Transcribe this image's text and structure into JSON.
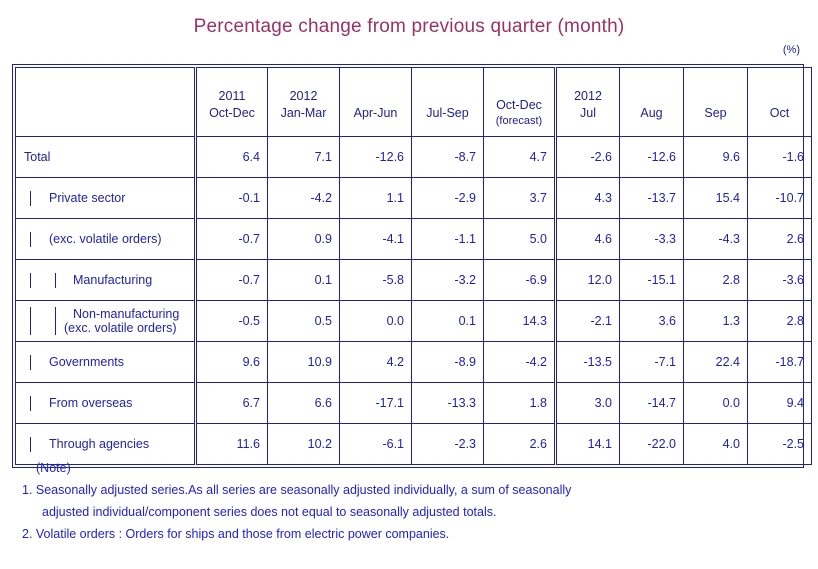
{
  "title": "Percentage change from previous quarter (month)",
  "unit": "(%)",
  "header": {
    "blank": "",
    "quarters": [
      {
        "year": "2011",
        "period": "Oct-Dec",
        "sub": ""
      },
      {
        "year": "2012",
        "period": "Jan-Mar",
        "sub": ""
      },
      {
        "year": "",
        "period": "Apr-Jun",
        "sub": ""
      },
      {
        "year": "",
        "period": "Jul-Sep",
        "sub": ""
      },
      {
        "year": "",
        "period": "Oct-Dec",
        "sub": "(forecast)"
      }
    ],
    "months": [
      {
        "year": "2012",
        "period": "Jul",
        "sub": ""
      },
      {
        "year": "",
        "period": "Aug",
        "sub": ""
      },
      {
        "year": "",
        "period": "Sep",
        "sub": ""
      },
      {
        "year": "",
        "period": "Oct",
        "sub": ""
      }
    ]
  },
  "rows": [
    {
      "label": "Total",
      "label2": "",
      "level": 0,
      "values": [
        "6.4",
        "7.1",
        "-12.6",
        "-8.7",
        "4.7",
        "-2.6",
        "-12.6",
        "9.6",
        "-1.6"
      ]
    },
    {
      "label": "Private sector",
      "label2": "",
      "level": 1,
      "values": [
        "-0.1",
        "-4.2",
        "1.1",
        "-2.9",
        "3.7",
        "4.3",
        "-13.7",
        "15.4",
        "-10.7"
      ]
    },
    {
      "label": "(exc. volatile orders)",
      "label2": "",
      "level": 1,
      "values": [
        "-0.7",
        "0.9",
        "-4.1",
        "-1.1",
        "5.0",
        "4.6",
        "-3.3",
        "-4.3",
        "2.6"
      ]
    },
    {
      "label": "Manufacturing",
      "label2": "",
      "level": 2,
      "values": [
        "-0.7",
        "0.1",
        "-5.8",
        "-3.2",
        "-6.9",
        "12.0",
        "-15.1",
        "2.8",
        "-3.6"
      ]
    },
    {
      "label": "Non-manufacturing",
      "label2": "(exc. volatile orders)",
      "level": 2,
      "values": [
        "-0.5",
        "0.5",
        "0.0",
        "0.1",
        "14.3",
        "-2.1",
        "3.6",
        "1.3",
        "2.8"
      ]
    },
    {
      "label": "Governments",
      "label2": "",
      "level": 1,
      "values": [
        "9.6",
        "10.9",
        "4.2",
        "-8.9",
        "-4.2",
        "-13.5",
        "-7.1",
        "22.4",
        "-18.7"
      ]
    },
    {
      "label": "From overseas",
      "label2": "",
      "level": 1,
      "values": [
        "6.7",
        "6.6",
        "-17.1",
        "-13.3",
        "1.8",
        "3.0",
        "-14.7",
        "0.0",
        "9.4"
      ]
    },
    {
      "label": "Through agencies",
      "label2": "",
      "level": 1,
      "values": [
        "11.6",
        "10.2",
        "-6.1",
        "-2.3",
        "2.6",
        "14.1",
        "-22.0",
        "4.0",
        "-2.5"
      ]
    }
  ],
  "notes": {
    "heading": "(Note)",
    "item1_line1": "1. Seasonally adjusted series.As all series are seasonally adjusted individually,  a sum of seasonally",
    "item1_line2": "adjusted individual/component series does not equal to seasonally adjusted totals.",
    "item2": "2. Volatile orders : Orders for ships and those from electric power companies."
  },
  "colors": {
    "title": "#993366",
    "border": "#22228b",
    "label_text": "#2222aa",
    "value_text": "#006600",
    "note_text": "#2222cc"
  }
}
